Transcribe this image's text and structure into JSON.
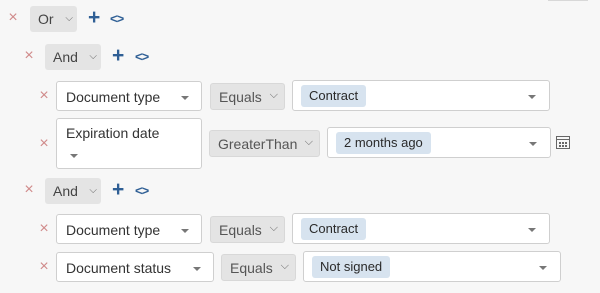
{
  "root": {
    "remove_icon": "×",
    "logic": "Or",
    "logic_chevron": "⌵",
    "add_icon": "+",
    "code_icon": "<>"
  },
  "groups": [
    {
      "logic": "And",
      "conditions": [
        {
          "field": "Document type",
          "operator": "Equals",
          "value": "Contract"
        },
        {
          "field": "Expiration date",
          "operator": "GreaterThan",
          "value": "2 months ago"
        }
      ]
    },
    {
      "logic": "And",
      "conditions": [
        {
          "field": "Document type",
          "operator": "Equals",
          "value": "Contract"
        },
        {
          "field": "Document status",
          "operator": "Equals",
          "value": "Not signed"
        }
      ]
    }
  ],
  "icons": {
    "remove": "×",
    "chevron": "⌵",
    "add": "+",
    "code": "<>"
  }
}
